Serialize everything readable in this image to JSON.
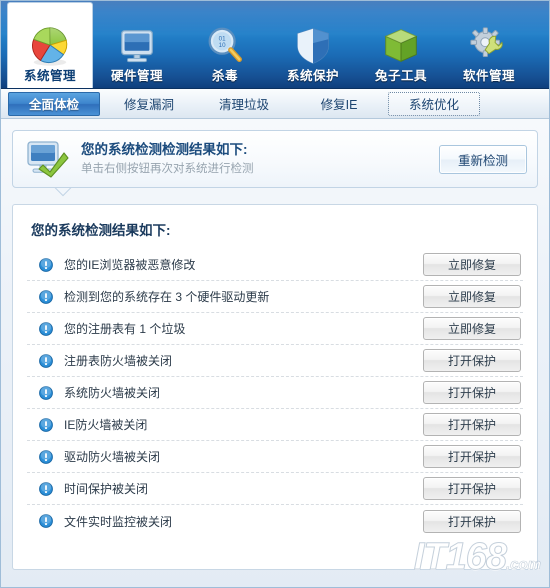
{
  "toolbar": {
    "items": [
      {
        "label": "系统管理",
        "icon": "pie-chart-icon",
        "active": true
      },
      {
        "label": "硬件管理",
        "icon": "monitor-icon",
        "active": false
      },
      {
        "label": "杀毒",
        "icon": "magnifier-icon",
        "active": false
      },
      {
        "label": "系统保护",
        "icon": "shield-icon",
        "active": false
      },
      {
        "label": "兔子工具",
        "icon": "green-box-icon",
        "active": false
      },
      {
        "label": "软件管理",
        "icon": "gear-wrench-icon",
        "active": false
      }
    ]
  },
  "tabs": [
    {
      "label": "全面体检",
      "state": "active"
    },
    {
      "label": "修复漏洞",
      "state": "normal"
    },
    {
      "label": "清理垃圾",
      "state": "normal"
    },
    {
      "label": "修复IE",
      "state": "normal"
    },
    {
      "label": "系统优化",
      "state": "focused"
    }
  ],
  "banner": {
    "icon": "monitor-check-icon",
    "title": "您的系统检测检测结果如下:",
    "subtitle": "单击右侧按钮再次对系统进行检测",
    "button_label": "重新检测"
  },
  "results": {
    "title": "您的系统检测结果如下:",
    "rows": [
      {
        "icon": "warning-icon",
        "text": "您的IE浏览器被恶意修改",
        "action": "立即修复"
      },
      {
        "icon": "warning-icon",
        "text": "检测到您的系统存在 3 个硬件驱动更新",
        "action": "立即修复"
      },
      {
        "icon": "warning-icon",
        "text": "您的注册表有 1 个垃圾",
        "action": "立即修复"
      },
      {
        "icon": "warning-icon",
        "text": "注册表防火墙被关闭",
        "action": "打开保护"
      },
      {
        "icon": "warning-icon",
        "text": "系统防火墙被关闭",
        "action": "打开保护"
      },
      {
        "icon": "warning-icon",
        "text": "IE防火墙被关闭",
        "action": "打开保护"
      },
      {
        "icon": "warning-icon",
        "text": "驱动防火墙被关闭",
        "action": "打开保护"
      },
      {
        "icon": "warning-icon",
        "text": "时间保护被关闭",
        "action": "打开保护"
      },
      {
        "icon": "warning-icon",
        "text": "文件实时监控被关闭",
        "action": "打开保护"
      }
    ]
  },
  "watermark": {
    "brand": "IT168",
    "suffix": ".com"
  },
  "colors": {
    "toolbar_blue": "#1a6fc0",
    "tab_active": "#3d85cd",
    "warning_blue": "#2b8fd8",
    "banner_title": "#1b4b7d",
    "panel_bg": "#ffffff"
  }
}
